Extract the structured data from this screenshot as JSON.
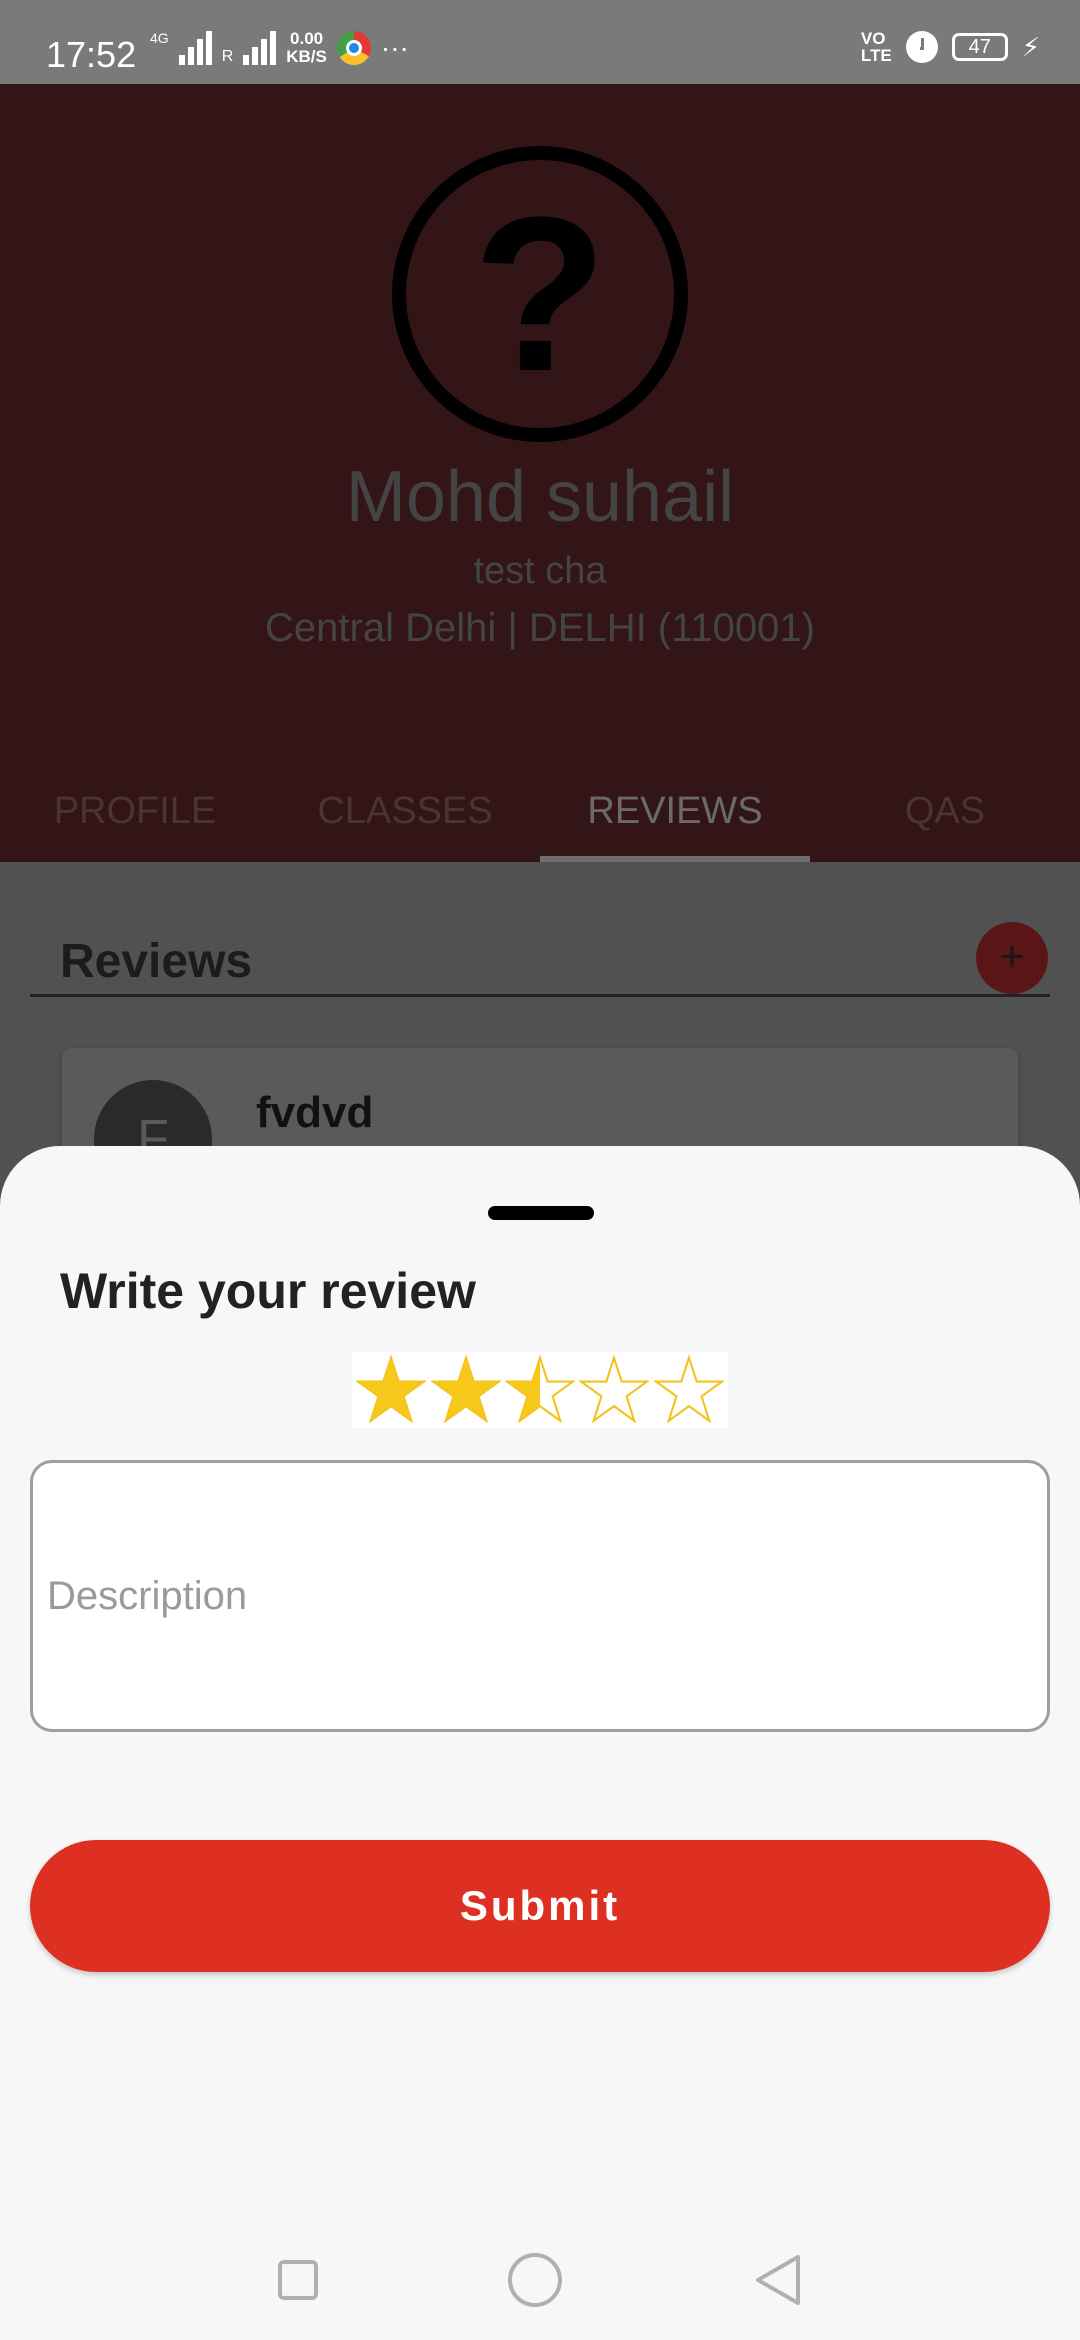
{
  "status_bar": {
    "time": "17:52",
    "network": "4G",
    "roaming": "R",
    "speed_value": "0.00",
    "speed_unit": "KB/S",
    "more": "···",
    "volte_top": "VO",
    "volte_bottom": "LTE",
    "battery": "47"
  },
  "profile": {
    "avatar_glyph": "?",
    "name": "Mohd suhail",
    "subtitle": "test cha",
    "location": "Central Delhi | DELHI (110001)"
  },
  "tabs": [
    {
      "label": "PROFILE"
    },
    {
      "label": "CLASSES"
    },
    {
      "label": "REVIEWS"
    },
    {
      "label": "QAS"
    }
  ],
  "active_tab": "REVIEWS",
  "reviews": {
    "heading": "Reviews",
    "add_symbol": "+",
    "items": [
      {
        "initial": "F",
        "name": "fvdvd"
      }
    ]
  },
  "sheet": {
    "title": "Write your review",
    "rating": 2.5,
    "rating_max": 5,
    "description_placeholder": "Description",
    "description_value": "",
    "submit_label": "Submit"
  },
  "colors": {
    "accent": "#dd3023",
    "star_fill": "#f6c81a",
    "star_outline": "#f2c21e"
  },
  "icons": {
    "back": "back-triangle-icon",
    "home": "home-circle-icon",
    "recents": "recents-square-icon"
  }
}
